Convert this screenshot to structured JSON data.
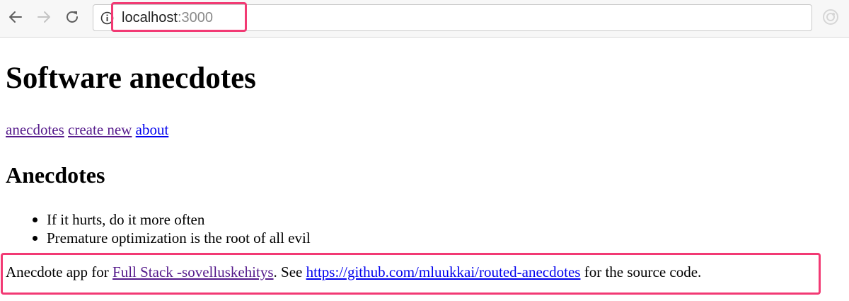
{
  "browser": {
    "url_host": "localhost",
    "url_port": ":3000",
    "icons": {
      "back": "arrow-left-icon",
      "forward": "arrow-right-icon",
      "reload": "reload-icon",
      "info": "info-circle-icon",
      "extension": "extension-icon"
    },
    "highlight_color": "#f23a74"
  },
  "page": {
    "title": "Software anecdotes",
    "nav": {
      "anecdotes": "anecdotes",
      "create_new": "create new",
      "about": "about"
    },
    "section_title": "Anecdotes",
    "anecdotes": [
      "If it hurts, do it more often",
      "Premature optimization is the root of all evil"
    ],
    "footer": {
      "prefix": "Anecdote app for ",
      "course_link": "Full Stack -sovelluskehitys",
      "middle": ". See ",
      "repo_link": "https://github.com/mluukkai/routed-anecdotes",
      "suffix": " for the source code."
    }
  },
  "colors": {
    "link": "#0000ee",
    "visited_link": "#551a8b"
  }
}
